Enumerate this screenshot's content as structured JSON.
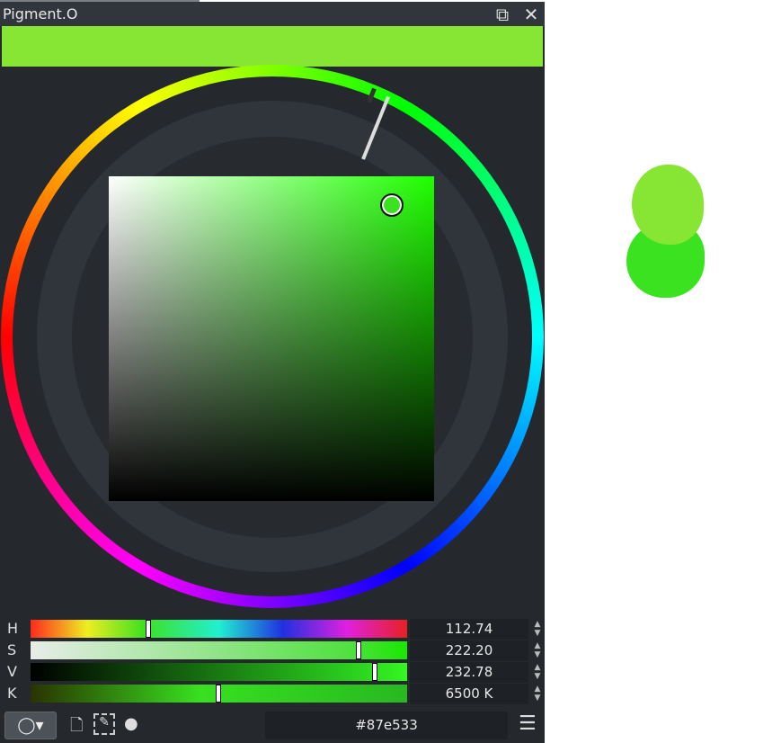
{
  "title": "Pigment.O",
  "current_color": "#87e533",
  "hue_color": "#1fff00",
  "sliders": [
    {
      "label": "H",
      "value": "112.74",
      "fraction": 0.3132,
      "gradient": "linear-gradient(to right,#ff2a1e,#eeee20 15%,#40e020 30%,#20f0d0 50%,#2030e0 67%,#e020e0 84%,#e82020)"
    },
    {
      "label": "S",
      "value": "222.20",
      "fraction": 0.8714,
      "gradient": "linear-gradient(to right,#e8ece8,#50e040 85%,#18e800)"
    },
    {
      "label": "V",
      "value": "232.78",
      "fraction": 0.9129,
      "gradient": "linear-gradient(to right,#000,#2ee020 92%,#34f820)"
    },
    {
      "label": "K",
      "value": "6500 K",
      "fraction": 0.4988,
      "gradient": "linear-gradient(to right,#2a3300,#38e020 45%,#28b820)"
    }
  ],
  "hex_value": "#87e533",
  "canvas_blobs": [
    "#87e533",
    "#3ae21f"
  ]
}
